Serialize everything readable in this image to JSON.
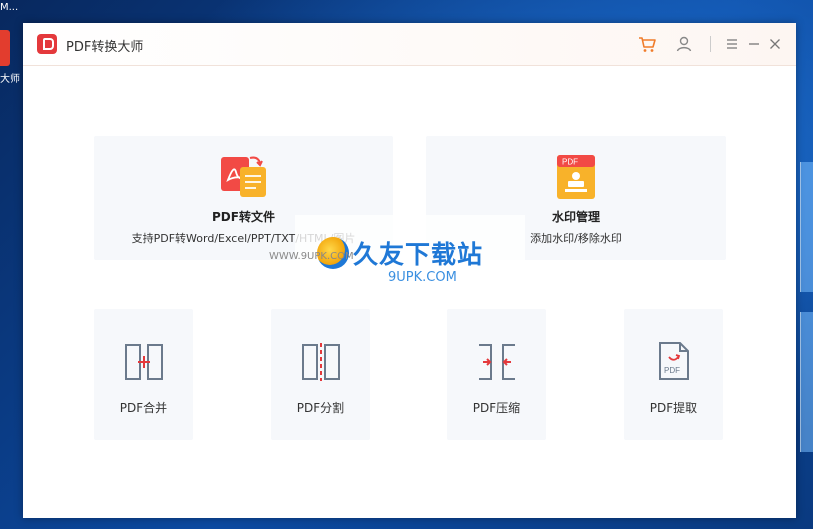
{
  "desktop": {
    "top_text": "M...",
    "icon_label": "大师"
  },
  "window": {
    "title": "PDF转换大师",
    "icons": [
      "cart-icon",
      "user-icon",
      "menu-icon",
      "minimize-icon",
      "close-icon"
    ]
  },
  "main": {
    "big_cards": [
      {
        "title": "PDF转文件",
        "desc": "支持PDF转Word/Excel/PPT/TXT/HTML/图片"
      },
      {
        "title": "水印管理",
        "desc": "添加水印/移除水印"
      }
    ],
    "small_cards": [
      {
        "label": "PDF合并"
      },
      {
        "label": "PDF分割"
      },
      {
        "label": "PDF压缩"
      },
      {
        "label": "PDF提取"
      }
    ]
  },
  "overlay": {
    "brand": "久友下载站",
    "url": "9UPK.COM",
    "left_url": "WWW.9UPK.COM"
  },
  "colors": {
    "accent": "#e4393c",
    "card_bg": "#f6f8fb",
    "icon_gray": "#6b7a8c",
    "cart_orange": "#f07c2a"
  }
}
